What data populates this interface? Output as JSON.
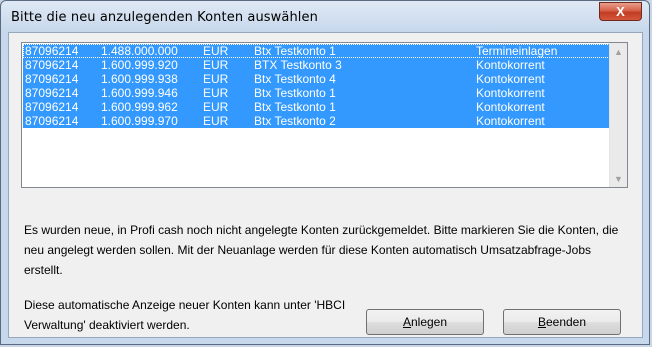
{
  "window": {
    "title": "Bitte die neu anzulegenden Konten auswählen",
    "close_label": "X"
  },
  "accounts": [
    {
      "blz": "87096214",
      "konto": "1.488.000.000",
      "currency": "EUR",
      "name": "Btx Testkonto 1",
      "type": "Termineinlagen"
    },
    {
      "blz": "87096214",
      "konto": "1.600.999.920",
      "currency": "EUR",
      "name": "BTX Testkonto 3",
      "type": "Kontokorrent"
    },
    {
      "blz": "87096214",
      "konto": "1.600.999.938",
      "currency": "EUR",
      "name": "Btx Testkonto 4",
      "type": "Kontokorrent"
    },
    {
      "blz": "87096214",
      "konto": "1.600.999.946",
      "currency": "EUR",
      "name": "Btx Testkonto 1",
      "type": "Kontokorrent"
    },
    {
      "blz": "87096214",
      "konto": "1.600.999.962",
      "currency": "EUR",
      "name": "Btx Testkonto 1",
      "type": "Kontokorrent"
    },
    {
      "blz": "87096214",
      "konto": "1.600.999.970",
      "currency": "EUR",
      "name": "Btx Testkonto 2",
      "type": "Kontokorrent"
    }
  ],
  "message": "Es wurden neue, in Profi cash noch nicht angelegte Konten zurückgemeldet. Bitte markieren Sie die Konten, die neu angelegt werden sollen. Mit der Neuanlage werden für diese Konten automatisch Umsatzabfrage-Jobs erstellt.",
  "hint": "Diese automatische Anzeige neuer Konten kann unter 'HBCI Verwaltung' deaktiviert werden.",
  "buttons": {
    "anlegen_mnemonic": "A",
    "anlegen_rest": "nlegen",
    "beenden_mnemonic": "B",
    "beenden_rest": "eenden"
  },
  "colors": {
    "selection": "#3399ff",
    "close_button": "#c13c22"
  }
}
